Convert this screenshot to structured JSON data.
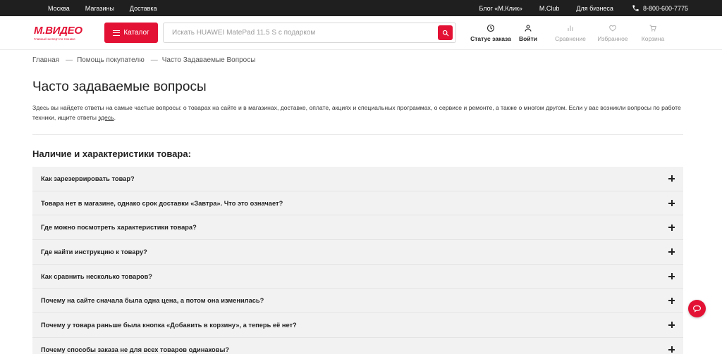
{
  "topbar": {
    "city": "Москва",
    "stores": "Магазины",
    "delivery": "Доставка",
    "blog": "Блог «М.Клик»",
    "mclub": "M.Club",
    "business": "Для бизнеса",
    "phone": "8-800-600-7775"
  },
  "header": {
    "logo_text": "М.ВИДЕО",
    "logo_tagline": "Главный эксперт по технике",
    "catalog_label": "Каталог",
    "search_placeholder": "Искать HUAWEI MatePad 11.5 S с подарком",
    "actions": {
      "order_status": "Статус заказа",
      "login": "Войти",
      "compare": "Сравнение",
      "favorites": "Избранное",
      "cart": "Корзина"
    }
  },
  "breadcrumb": {
    "home": "Главная",
    "help": "Помощь покупателю",
    "current": "Часто Задаваемые Вопросы"
  },
  "page": {
    "title": "Часто задаваемые вопросы",
    "intro": "Здесь вы найдете ответы на самые частые вопросы: о товарах на сайте и в магазинах, доставке, оплате, акциях и специальных программах, о сервисе и ремонте, а также о многом другом. Если у вас возникли вопросы по работе техники, ищите ответы ",
    "intro_link": "здесь",
    "intro_end": ".",
    "section_title": "Наличие и характеристики товара:"
  },
  "faq": [
    "Как зарезервировать товар?",
    "Товара нет в магазине, однако срок доставки «Завтра». Что это означает?",
    "Где можно посмотреть характеристики товара?",
    "Где найти инструкцию к товару?",
    "Как сравнить несколько товаров?",
    "Почему на сайте сначала была одна цена, а потом она изменилась?",
    "Почему у товара раньше была кнопка «Добавить в корзину», а теперь её нет?",
    "Почему способы заказа не для всех товаров одинаковы?"
  ],
  "colors": {
    "brand": "#e31235",
    "topbar": "#1f1f1f",
    "faq_bg": "#f2f2f2"
  },
  "icons": {
    "phone": "phone-icon",
    "search": "search-icon",
    "chat": "chat-icon"
  }
}
